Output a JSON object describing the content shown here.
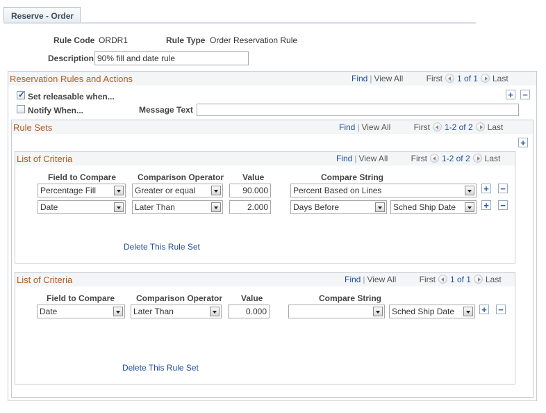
{
  "tab": {
    "label": "Reserve - Order"
  },
  "header": {
    "rule_code_label": "Rule Code",
    "rule_code_value": "ORDR1",
    "rule_type_label": "Rule Type",
    "rule_type_value": "Order Reservation Rule",
    "description_label": "Description",
    "description_value": "90% fill and date rule"
  },
  "reservation": {
    "title": "Reservation Rules and Actions",
    "find": "Find",
    "view_all": "View All",
    "first": "First",
    "count": "1 of 1",
    "last": "Last",
    "set_releasable_label": "Set releasable when...",
    "set_releasable_checked": true,
    "notify_label": "Notify When...",
    "notify_checked": false,
    "message_text_label": "Message Text",
    "message_text_value": ""
  },
  "rule_sets": {
    "title": "Rule Sets",
    "find": "Find",
    "view_all": "View All",
    "first": "First",
    "count": "1-2 of 2",
    "last": "Last"
  },
  "criteria_lists": [
    {
      "title": "List of Criteria",
      "find": "Find",
      "view_all": "View All",
      "first": "First",
      "count": "1-2 of 2",
      "last": "Last",
      "columns": [
        "Field to Compare",
        "Comparison Operator",
        "Value",
        "Compare String"
      ],
      "rows": [
        {
          "field": "Percentage Fill",
          "operator": "Greater or equal",
          "value": "90.000",
          "compare1": "Percent Based on Lines",
          "compare2": null
        },
        {
          "field": "Date",
          "operator": "Later Than",
          "value": "2.000",
          "compare1": "Days Before",
          "compare2": "Sched Ship Date"
        }
      ],
      "delete_label": "Delete This Rule Set"
    },
    {
      "title": "List of Criteria",
      "find": "Find",
      "view_all": "View All",
      "first": "First",
      "count": "1 of 1",
      "last": "Last",
      "columns": [
        "Field to Compare",
        "Comparison Operator",
        "Value",
        "Compare String"
      ],
      "rows": [
        {
          "field": "Date",
          "operator": "Later Than",
          "value": "0.000",
          "compare1": "",
          "compare2": "Sched Ship Date"
        }
      ],
      "delete_label": "Delete This Rule Set"
    }
  ]
}
